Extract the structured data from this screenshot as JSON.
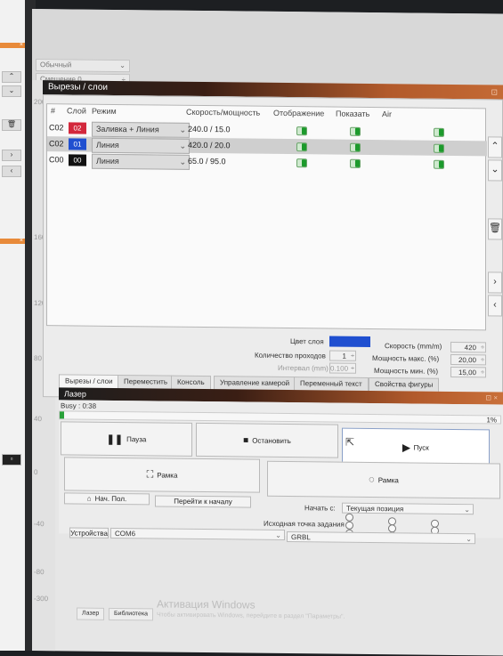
{
  "top_controls": {
    "mode": "Обычный",
    "offset": "Смещение 0"
  },
  "ruler_labels": [
    "200",
    "160",
    "120",
    "80",
    "40",
    "0",
    "-40",
    "-80",
    "-300"
  ],
  "cuts": {
    "title": "Вырезы / слои",
    "headers": [
      "#",
      "Слой",
      "Режим",
      "Скорость/мощность",
      "Отображение",
      "Показать",
      "Air"
    ],
    "rows": [
      {
        "id": "C02",
        "layer": "02",
        "color": "#d3283c",
        "mode": "Заливка + Линия",
        "speed_power": "240.0 / 15.0"
      },
      {
        "id": "C02",
        "layer": "01",
        "color": "#1f4fd0",
        "mode": "Линия",
        "speed_power": "420.0 / 20.0"
      },
      {
        "id": "C00",
        "layer": "00",
        "color": "#111111",
        "mode": "Линия",
        "speed_power": "65.0 / 95.0"
      }
    ],
    "form": {
      "layer_color_label": "Цвет слоя",
      "layer_color": "#1f4fd0",
      "speed_label": "Скорость (mm/m)",
      "speed_value": "420",
      "passes_label": "Количество проходов",
      "passes_value": "1",
      "max_power_label": "Мощность макс. (%)",
      "max_power_value": "20,00",
      "interval_label": "Интервал (mm)",
      "interval_value": "0.100",
      "min_power_label": "Мощность мин. (%)",
      "min_power_value": "15,00"
    },
    "tabs": [
      "Вырезы / слои",
      "Переместить",
      "Консоль",
      "Управление камерой",
      "Переменный текст",
      "Свойства фигуры"
    ]
  },
  "laser": {
    "title": "Лазер",
    "status": "Busy : 0:38",
    "progress": "1%",
    "progress_fraction": 0.01,
    "pause": "Пауза",
    "stop": "Остановить",
    "start": "Пуск",
    "frame1": "Рамка",
    "frame2": "Рамка",
    "home": "Нач. Пол.",
    "goto_origin": "Перейти к началу",
    "start_from_label": "Начать с:",
    "start_from_value": "Текущая позиция",
    "origin_label": "Исходная точка задания",
    "devices_btn": "Устройства",
    "port": "COM6",
    "controller": "GRBL"
  },
  "bottom_tabs": [
    "Лазер",
    "Библиотека"
  ],
  "watermark": {
    "title": "Активация Windows",
    "subtitle": "Чтобы активировать Windows, перейдите в раздел \"Параметры\"."
  }
}
